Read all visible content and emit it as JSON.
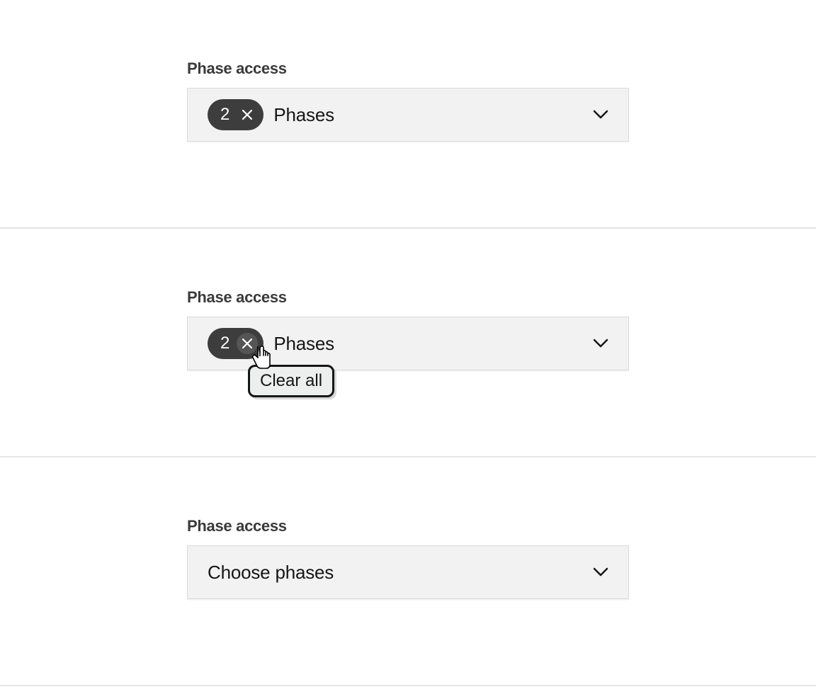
{
  "panels": [
    {
      "label": "Phase access",
      "count": "2",
      "text": "Phases"
    },
    {
      "label": "Phase access",
      "count": "2",
      "text": "Phases",
      "tooltip": "Clear all"
    },
    {
      "label": "Phase access",
      "placeholder": "Choose phases"
    }
  ]
}
